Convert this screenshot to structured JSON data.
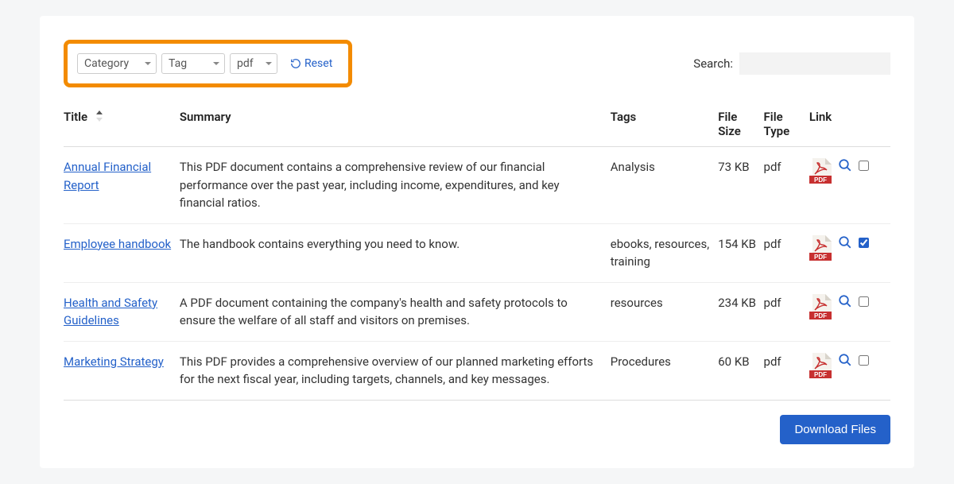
{
  "filters": {
    "category": "Category",
    "tag": "Tag",
    "filetype": "pdf",
    "reset": "Reset"
  },
  "search": {
    "label": "Search:",
    "value": ""
  },
  "columns": {
    "title": "Title",
    "summary": "Summary",
    "tags": "Tags",
    "file_size": "File Size",
    "file_type": "File Type",
    "link": "Link"
  },
  "rows": [
    {
      "title": "Annual Financial Report",
      "summary": "This PDF document contains a comprehensive review of our financial performance over the past year, including income, expenditures, and key financial ratios.",
      "tags": "Analysis",
      "size": "73 KB",
      "type": "pdf",
      "checked": false
    },
    {
      "title": "Employee handbook",
      "summary": "The handbook contains everything you need to know.",
      "tags": "ebooks, resources, training",
      "size": "154 KB",
      "type": "pdf",
      "checked": true
    },
    {
      "title": "Health and Safety Guidelines",
      "summary": "A PDF document containing the company's health and safety protocols to ensure the welfare of all staff and visitors on premises.",
      "tags": "resources",
      "size": "234 KB",
      "type": "pdf",
      "checked": false
    },
    {
      "title": "Marketing Strategy",
      "summary": "This PDF provides a comprehensive overview of our planned marketing efforts for the next fiscal year, including targets, channels, and key messages.",
      "tags": "Procedures",
      "size": "60 KB",
      "type": "pdf",
      "checked": false
    }
  ],
  "download_label": "Download Files"
}
